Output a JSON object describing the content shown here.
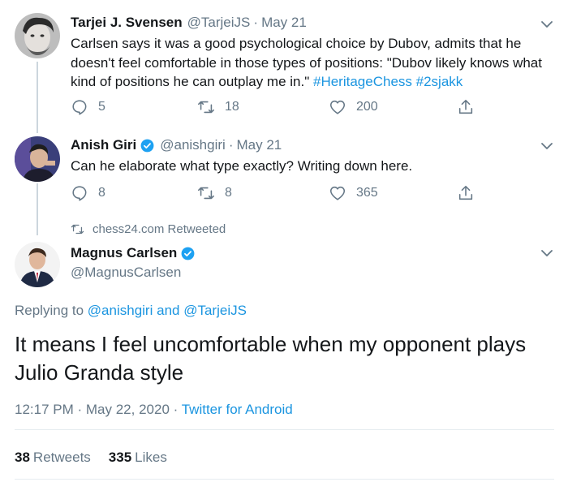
{
  "tweets": [
    {
      "display_name": "Tarjei J. Svensen",
      "handle": "@TarjeiJS",
      "date": "May 21",
      "verified": false,
      "text_plain": "Carlsen says it was a good psychological choice by Dubov, admits that he doesn't feel comfortable in those types of positions: \"Dubov likely knows what kind of positions he can outplay me in.\"",
      "hashtag1": "#HeritageChess",
      "hashtag2": "#2sjakk",
      "replies": "5",
      "retweets": "18",
      "likes": "200"
    },
    {
      "display_name": "Anish Giri",
      "handle": "@anishgiri",
      "date": "May 21",
      "verified": true,
      "text_plain": "Can he elaborate what type exactly? Writing down here.",
      "replies": "8",
      "retweets": "8",
      "likes": "365"
    }
  ],
  "retweeted_by": "chess24.com Retweeted",
  "main_tweet": {
    "display_name": "Magnus Carlsen",
    "handle": "@MagnusCarlsen",
    "verified": true,
    "replying_prefix": "Replying to",
    "replying_to_1": "@anishgiri",
    "replying_and": "and",
    "replying_to_2": "@TarjeiJS",
    "text": "It means I feel uncomfortable when my opponent plays Julio Granda style",
    "time": "12:17 PM",
    "date": "May 22, 2020",
    "source": "Twitter for Android",
    "retweets_count": "38",
    "retweets_label": "Retweets",
    "likes_count": "335",
    "likes_label": "Likes"
  },
  "colors": {
    "link": "#1b95e0",
    "secondary_text": "#657786",
    "verified": "#1da1f2",
    "thread_line": "#ccd6dd"
  }
}
